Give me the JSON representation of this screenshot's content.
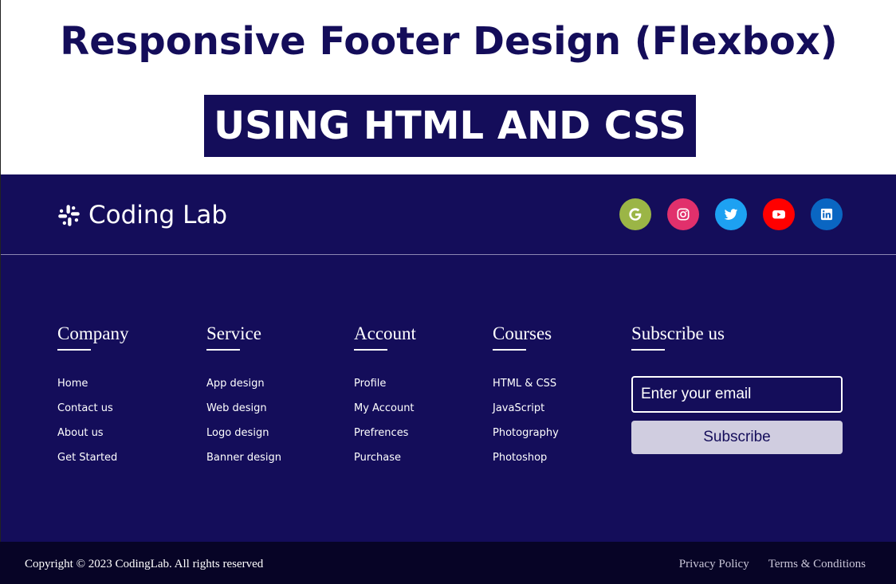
{
  "banner": {
    "title": "Responsive Footer Design (Flexbox)",
    "subtitle": "USING HTML AND CSS"
  },
  "brand": {
    "icon": "slack-icon",
    "name": "Coding Lab"
  },
  "socials": [
    {
      "icon": "google-icon",
      "color": "#9bb546"
    },
    {
      "icon": "instagram-icon",
      "color": "#e1306c"
    },
    {
      "icon": "twitter-icon",
      "color": "#1da1f2"
    },
    {
      "icon": "youtube-icon",
      "color": "#ff0000"
    },
    {
      "icon": "linkedin-icon",
      "color": "#0a66c2"
    }
  ],
  "columns": [
    {
      "title": "Company",
      "links": [
        "Home",
        "Contact us",
        "About us",
        "Get Started"
      ]
    },
    {
      "title": "Service",
      "links": [
        "App design",
        "Web design",
        "Logo design",
        "Banner design"
      ]
    },
    {
      "title": "Account",
      "links": [
        "Profile",
        "My Account",
        "Prefrences",
        "Purchase"
      ]
    },
    {
      "title": "Courses",
      "links": [
        "HTML & CSS",
        "JavaScript",
        "Photography",
        "Photoshop"
      ]
    }
  ],
  "subscribe": {
    "title": "Subscribe us",
    "placeholder": "Enter your email",
    "button": "Subscribe"
  },
  "bottom": {
    "copyright": "Copyright © 2023 CodingLab. All rights reserved",
    "links": [
      "Privacy Policy",
      "Terms & Conditions"
    ]
  },
  "colors": {
    "primary": "#140d5a",
    "bottom_bar": "#070426",
    "button_bg": "#d0cde0"
  }
}
